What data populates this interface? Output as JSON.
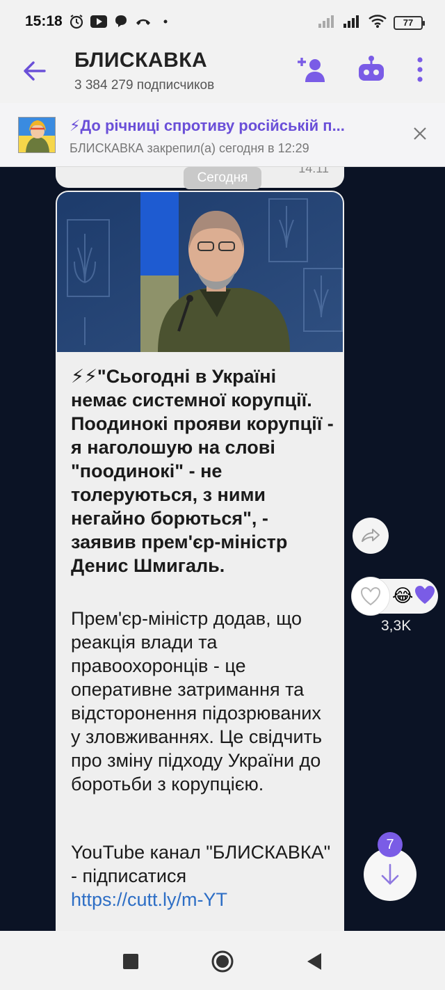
{
  "status_bar": {
    "time": "15:18",
    "battery": "77",
    "icons": [
      "alarm-icon",
      "youtube-icon",
      "viber-icon",
      "call-icon",
      "dot-icon",
      "signal-icon",
      "signal-icon",
      "wifi-icon",
      "battery-icon"
    ]
  },
  "header": {
    "title": "БЛИСКАВКА",
    "subscribers": "3 384 279 подписчиков",
    "accent": "#7a5ce6"
  },
  "pinned": {
    "title": "⚡До річниці спротиву російській п...",
    "subtitle": "БЛИСКАВКА закрепил(а) сегодня в 12:29"
  },
  "prev_message": {
    "time": "14:11"
  },
  "date_separator": "Сегодня",
  "post": {
    "bold_text": "⚡⚡\"Сьогодні в Україні немає системної корупції. Поодинокі прояви корупції - я наголошую на слові \"поодинокі\" - не толеруються, з ними негайно борються\", - заявив прем'єр-міністр Денис Шмигаль.",
    "body_text": "Прем'єр-міністр додав, що реакція влади та правоохоронців - це оперативне затримання та відсторонення підозрюваних у зловживаннях. Це свідчить про зміну підходу України до боротьби з корупцією.",
    "yt_text": "YouTube канал \"БЛИСКАВКА\" - підписатися",
    "link": "https://cutt.ly/m-YT"
  },
  "reactions": {
    "emoji": "😂",
    "count": "3,3K"
  },
  "scroll": {
    "unread": "7"
  }
}
